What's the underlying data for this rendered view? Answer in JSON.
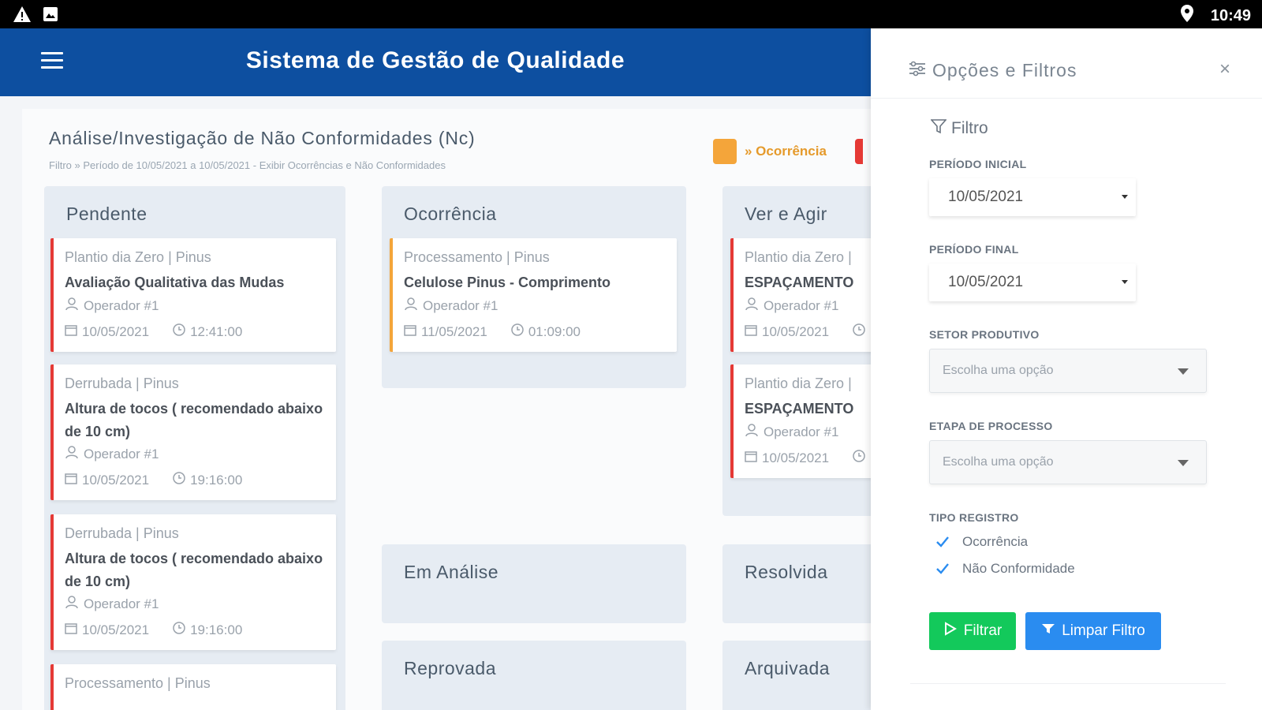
{
  "status_bar": {
    "time": "10:49",
    "icons": [
      "warning-icon",
      "image-icon",
      "location-pin-icon"
    ]
  },
  "app_bar": {
    "title": "Sistema de Gestão de Qualidade"
  },
  "page": {
    "title": "Análise/Investigação de Não Conformidades (Nc)",
    "subtitle": "Filtro » Período de 10/05/2021 a 10/05/2021 - Exibir Ocorrências e Não Conformidades",
    "legend": {
      "label": "» Ocorrência",
      "color": "#f4a53a",
      "second_color": "#e53935"
    }
  },
  "columns": {
    "pendente": {
      "title": "Pendente",
      "cards": [
        {
          "category": "Plantio dia Zero | Pinus",
          "title": "Avaliação Qualitativa das Mudas",
          "operator": "Operador #1",
          "date": "10/05/2021",
          "time": "12:41:00"
        },
        {
          "category": "Derrubada | Pinus",
          "title": "Altura de tocos ( recomendado abaixo de 10 cm)",
          "operator": "Operador #1",
          "date": "10/05/2021",
          "time": "19:16:00"
        },
        {
          "category": "Derrubada | Pinus",
          "title": "Altura de tocos ( recomendado abaixo de 10 cm)",
          "operator": "Operador #1",
          "date": "10/05/2021",
          "time": "19:16:00"
        },
        {
          "category": "Processamento | Pinus"
        }
      ]
    },
    "ocorrencia": {
      "title": "Ocorrência",
      "cards": [
        {
          "category": "Processamento | Pinus",
          "title": "Celulose Pinus - Comprimento",
          "operator": "Operador #1",
          "date": "11/05/2021",
          "time": "01:09:00"
        }
      ]
    },
    "ver_agir": {
      "title": "Ver e Agir",
      "cards": [
        {
          "category": "Plantio dia Zero |",
          "title": "ESPAÇAMENTO",
          "operator": "Operador #1",
          "date": "10/05/2021"
        },
        {
          "category": "Plantio dia Zero |",
          "title": "ESPAÇAMENTO",
          "operator": "Operador #1",
          "date": "10/05/2021"
        }
      ]
    },
    "em_analise": {
      "title": "Em Análise"
    },
    "resolvida": {
      "title": "Resolvida"
    },
    "reprovada": {
      "title": "Reprovada"
    },
    "arquivada": {
      "title": "Arquivada"
    }
  },
  "panel": {
    "title": "Opções e Filtros",
    "close": "×",
    "filter_heading": "Filtro",
    "periodo_inicial": {
      "label": "PERÍODO INICIAL",
      "value": "10/05/2021"
    },
    "periodo_final": {
      "label": "PERÍODO FINAL",
      "value": "10/05/2021"
    },
    "setor_produtivo": {
      "label": "SETOR PRODUTIVO",
      "placeholder": "Escolha uma opção"
    },
    "etapa_processo": {
      "label": "ETAPA DE PROCESSO",
      "placeholder": "Escolha uma opção"
    },
    "tipo_registro": {
      "label": "TIPO REGISTRO",
      "options": [
        {
          "label": "Ocorrência",
          "checked": true
        },
        {
          "label": "Não Conformidade",
          "checked": true
        }
      ]
    },
    "filter_button": "Filtrar",
    "clear_button": "Limpar Filtro"
  }
}
